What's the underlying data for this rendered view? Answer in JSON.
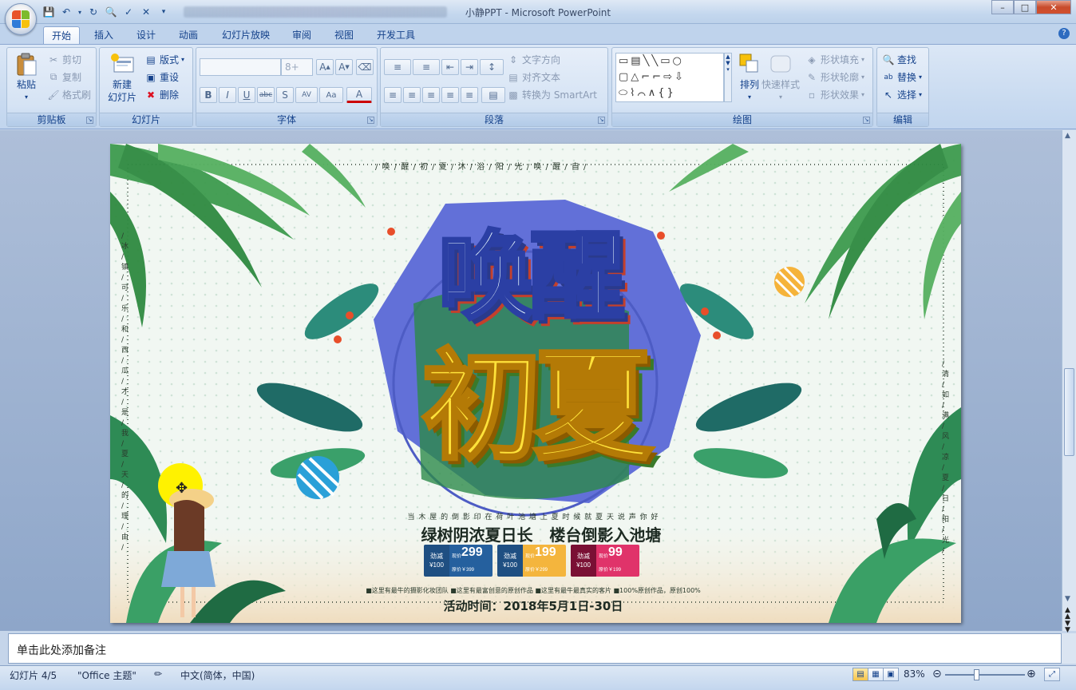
{
  "window": {
    "title": "小静PPT - Microsoft PowerPoint"
  },
  "tabs": [
    "开始",
    "插入",
    "设计",
    "动画",
    "幻灯片放映",
    "审阅",
    "视图",
    "开发工具"
  ],
  "ribbon": {
    "clipboard": {
      "label": "剪贴板",
      "paste": "粘贴",
      "cut": "剪切",
      "copy": "复制",
      "format_painter": "格式刷"
    },
    "slides": {
      "label": "幻灯片",
      "new_slide_1": "新建",
      "new_slide_2": "幻灯片",
      "layout": "版式",
      "reset": "重设",
      "delete": "删除"
    },
    "font": {
      "label": "字体",
      "font_name": "",
      "font_size": "8+"
    },
    "paragraph": {
      "label": "段落",
      "text_direction": "文字方向",
      "align_text": "对齐文本",
      "convert_smartart": "转换为 SmartArt"
    },
    "drawing": {
      "label": "绘图",
      "arrange": "排列",
      "quick_styles": "快速样式",
      "shape_fill": "形状填充",
      "shape_outline": "形状轮廓",
      "shape_effects": "形状效果"
    },
    "editing": {
      "label": "编辑",
      "find": "查找",
      "replace": "替换",
      "select": "选择"
    }
  },
  "slide": {
    "top_ribbon_text": "/ 唤 / 醒 / 初 / 夏 / 沐 / 浴 / 阳 / 光 / 唤 / 醒 / 自 /",
    "left_vertical_text": "/ 冰 / 镇 / 可 / 乐 / 和 / 西 / 瓜 / 才 / 是 / 我 / 夏 / 天 / 的 / 理 / 由 /",
    "right_vertical_text": "/ 清 / 如 / 满 / 风 / 凉 / 夏 / 日 / 阳 / 光 /",
    "title_line1": "唤醒",
    "title_line2": "初夏",
    "small_caption": "当 木 屋 的 倒 影 印 在 荷 叶 池 塘 上 夏 时 候 就 夏 天 说 声 你 好",
    "slogan": "绿树阴浓夏日长   楼台倒影入池塘",
    "coupons": [
      {
        "tag": "劲减",
        "amount": "¥100",
        "now_label": "现价",
        "price": "299",
        "orig": "原价￥399",
        "color": "#1f4f82",
        "price_bg": "#25609e"
      },
      {
        "tag": "劲减",
        "amount": "¥100",
        "now_label": "现价",
        "price": "199",
        "orig": "原价￥299",
        "color": "#1f4f82",
        "price_bg": "#f4b53d"
      },
      {
        "tag": "劲减",
        "amount": "¥100",
        "now_label": "现价",
        "price": "99",
        "orig": "原价￥199",
        "color": "#7a1034",
        "price_bg": "#e0336a"
      }
    ],
    "features": "■这里有最牛的摄影化妆团队  ■这里有最富创意的原创作品  ■这里有最牛最真实的客片  ■100%原创作品，原创100%",
    "event_time": "活动时间：2018年5月1日-30日"
  },
  "notes": {
    "placeholder": "单击此处添加备注"
  },
  "status": {
    "slide_counter": "幻灯片 4/5",
    "theme": "\"Office 主题\"",
    "language": "中文(简体，中国)",
    "zoom": "83%"
  }
}
